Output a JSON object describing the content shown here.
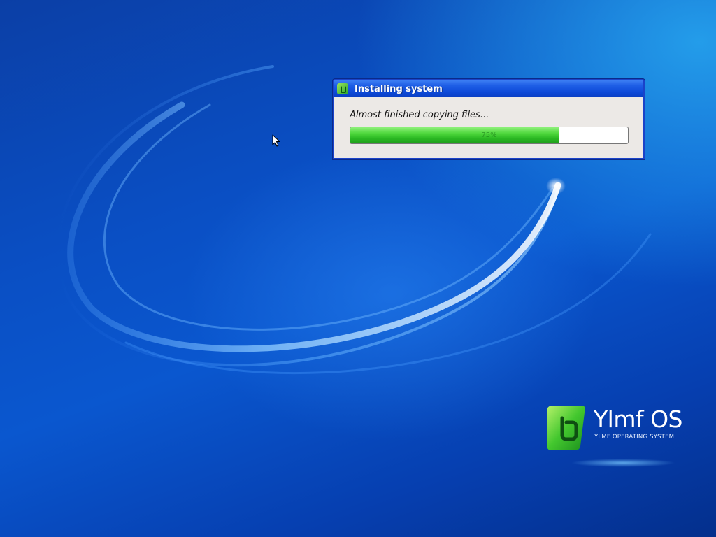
{
  "dialog": {
    "title": "Installing system",
    "status": "Almost finished copying files...",
    "progress": {
      "fraction": 0.75,
      "label": "75%"
    },
    "icon": "ylmf-app-icon"
  },
  "branding": {
    "name": "Ylmf OS",
    "tagline": "YLMF OPERATING SYSTEM",
    "logo_color": "#3fc42f"
  },
  "desktop": {
    "cursor": "arrow-cursor-icon"
  }
}
